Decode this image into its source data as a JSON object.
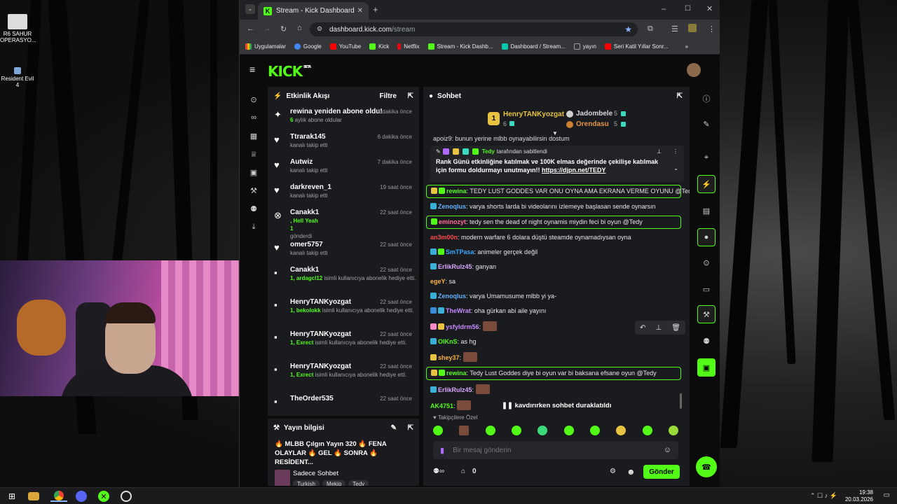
{
  "desktop": {
    "icons": [
      {
        "label": "R6 SAHUR OPERASYO..."
      },
      {
        "label": "Resident Evil 4"
      }
    ]
  },
  "browser": {
    "tab_title": "Stream - Kick Dashboard",
    "new_tab": "+",
    "url_domain": "dashboard.kick.com",
    "url_path": "/stream",
    "bookmarks": [
      {
        "label": "Uygulamalar",
        "color": "#e8eaed"
      },
      {
        "label": "Google",
        "color": "#4285f4"
      },
      {
        "label": "YouTube",
        "color": "#ff0000"
      },
      {
        "label": "Kick",
        "color": "#53fc18"
      },
      {
        "label": "Netflix",
        "color": "#e50914"
      },
      {
        "label": "Stream - Kick Dashb...",
        "color": "#53fc18"
      },
      {
        "label": "Dashboard / Stream...",
        "color": "#00c8af"
      },
      {
        "label": "yayın",
        "color": "#9aa0a6"
      },
      {
        "label": "Seri Katil Yıllar Sonr...",
        "color": "#ff0000"
      }
    ],
    "more_bookmarks": "»"
  },
  "kick": {
    "logo": "KICK",
    "logo_sup": "BETA",
    "activity": {
      "title": "Etkinlik Akışı",
      "filter": "Filtre",
      "items": [
        {
          "icon": "✦",
          "name": "rewina yeniden abone oldu!",
          "sub_green": "6",
          "sub": " aylık abone oldular",
          "time": "1 dakika önce"
        },
        {
          "icon": "♥",
          "name": "Ttrarak145",
          "sub_green": "",
          "sub": "kanalı takip etti",
          "time": "6 dakika önce"
        },
        {
          "icon": "♥",
          "name": "Autwiz",
          "sub_green": "",
          "sub": "kanalı takip etti",
          "time": "7 dakika önce"
        },
        {
          "icon": "♥",
          "name": "darkreven_1",
          "sub_green": "",
          "sub": "kanalı takip etti",
          "time": "19 saat önce"
        },
        {
          "icon": "⊗",
          "name": "Canakk1",
          "sub_green": ", Hell Yeah",
          "sub": "",
          "extra": "1",
          "extra2": "gönderdi",
          "time": "22 saat önce"
        },
        {
          "icon": "♥",
          "name": "omer5757",
          "sub_green": "",
          "sub": "kanalı takip etti",
          "time": "22 saat önce"
        },
        {
          "icon": "▪",
          "name": "Canakk1",
          "sub_green": "1, ardagcl12",
          "sub": " isimli kullanıcıya abonelik hediye etti.",
          "time": "22 saat önce"
        },
        {
          "icon": "▪",
          "name": "HenryTANKyozgat",
          "sub_green": "1, bekolokk",
          "sub": " isimli kullanıcıya abonelik hediye etti.",
          "time": "22 saat önce"
        },
        {
          "icon": "▪",
          "name": "HenryTANKyozgat",
          "sub_green": "1, Exrect",
          "sub": " isimli kullanıcıya abonelik hediye etti.",
          "time": "22 saat önce"
        },
        {
          "icon": "▪",
          "name": "HenryTANKyozgat",
          "sub_green": "1, Exrect",
          "sub": " isimli kullanıcıya abonelik hediye etti.",
          "time": "22 saat önce"
        },
        {
          "icon": "▪",
          "name": "TheOrder535",
          "sub_green": "",
          "sub": "",
          "time": "22 saat önce"
        }
      ]
    },
    "stream_info": {
      "title": "Yayın bilgisi",
      "stream_title": "🔥 MLBB Çılgın Yayın 320 🔥 FENA OLAYLAR 🔥 GEL 🔥 SONRA 🔥 RESİDENT...",
      "category": "Sadece Sohbet",
      "tags": [
        "Turkish",
        "Mekip",
        "Tedy"
      ]
    },
    "chat": {
      "title": "Sohbet",
      "leaderboard": {
        "first_rank": "1",
        "first_name": "HenryTANKyozgat",
        "first_value": "6",
        "second_name": "Jadombele",
        "second_value": "5",
        "third_name": "Orendasu",
        "third_value": "5"
      },
      "cut_line": "apoiz9: bunun yerine mlbb oynayabilirsin dostum",
      "pinned": {
        "by_name": "Tedy",
        "by_suffix": " tarafından sabitlendi",
        "text": "Rank Günü etkinliğine katılmak ve 100K elmas değerinde çekilişe katılmak için formu doldurmayı unutmayın!! ",
        "link": "https://djpn.net/TEDY"
      },
      "messages": [
        {
          "user": "rewina",
          "color": "#53fc18",
          "text": ": TEDY LUST GODDES VAR ONU OYNA AMA EKRANA VERME OYUNU @Tedy",
          "hl": true,
          "badges": [
            "#e7c341",
            "#53fc18"
          ]
        },
        {
          "user": "Zenoqlus",
          "color": "#66b2ff",
          "text": ": varya shorts larda bi videolarını izlemeye başlasan sende oynarsın",
          "hl": false,
          "badges": [
            "#3ab0d9"
          ]
        },
        {
          "user": "eminozyt",
          "color": "#ff6b9a",
          "text": ": tedy sen the dead of night oynamis miydin feci bi oyun @Tedy",
          "hl": true,
          "badges": [
            "#53fc18"
          ]
        },
        {
          "user": "an3m00n",
          "color": "#ff4a4a",
          "text": ": modern warfare 6 dolara düştü steamde oynamadıysan oyna",
          "hl": false,
          "badges": []
        },
        {
          "user": "SmTPasa",
          "color": "#3aa8ff",
          "text": ": animeler gerçek değil",
          "hl": false,
          "badges": [
            "#3ab0d9",
            "#53fc18"
          ]
        },
        {
          "user": "ErlikRulz45",
          "color": "#d9a6ff",
          "text": ": ganyan",
          "hl": false,
          "badges": [
            "#3ab0d9"
          ]
        },
        {
          "user": "egeY",
          "color": "#ffb347",
          "text": ": sa",
          "hl": false,
          "badges": []
        },
        {
          "user": "Zenoqlus",
          "color": "#66b2ff",
          "text": ": varya Umamusume mlbb yi ya-",
          "hl": false,
          "badges": [
            "#3ab0d9"
          ]
        },
        {
          "user": "TheWrat",
          "color": "#c78bff",
          "text": ": oha gürkan abi aile yayını",
          "hl": false,
          "badges": [
            "#3a8ad9",
            "#3ab0d9"
          ]
        },
        {
          "user": "ysfyldrm56",
          "color": "#c78bff",
          "text": ":",
          "hl": false,
          "badges": [
            "#ff8ac6",
            "#e7c341"
          ],
          "emote": true
        },
        {
          "user": "OlKnS",
          "color": "#53fc18",
          "text": ": as hg",
          "hl": false,
          "badges": [
            "#3ab0d9"
          ]
        },
        {
          "user": "shey37",
          "color": "#ffb347",
          "text": ":",
          "hl": false,
          "badges": [
            "#e7c341"
          ],
          "emote": true
        },
        {
          "user": "rewina",
          "color": "#53fc18",
          "text": ": Tedy Lust Goddes diye bi oyun var bi baksana efsane oyun @Tedy",
          "hl": true,
          "badges": [
            "#e7c341",
            "#53fc18"
          ]
        },
        {
          "user": "ErlikRulz45",
          "color": "#d9a6ff",
          "text": ":",
          "hl": false,
          "badges": [
            "#3ab0d9"
          ],
          "emote": true
        },
        {
          "user": "AK4751",
          "color": "#53fc18",
          "text": ":",
          "hl": false,
          "badges": [],
          "emote": true
        }
      ],
      "paused": "kavdırırken sohbet duraklatıldı",
      "followers_only": "Takipçilere Özel",
      "input_placeholder": "Bir mesaj gönderin",
      "viewers": "0",
      "send": "Gönder"
    }
  },
  "taskbar": {
    "time": "19:38",
    "date": "20.03.2026"
  },
  "colors": {
    "kick_green": "#53fc18",
    "panel": "#191b1f"
  }
}
